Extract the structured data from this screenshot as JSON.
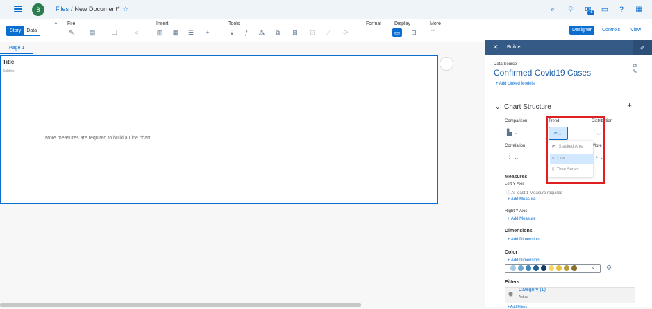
{
  "shell": {
    "avatar_letter": "8",
    "breadcrumb_root": "Files",
    "breadcrumb_sep": "/",
    "document_name": "New Document*",
    "notification_count": "48"
  },
  "toolbar": {
    "mode_story": "Story",
    "mode_data": "Data",
    "groups": {
      "file": "File",
      "insert": "Insert",
      "tools": "Tools",
      "format": "Format",
      "display": "Display",
      "more": "More"
    },
    "more_dots": "•••",
    "views": {
      "designer": "Designer",
      "controls": "Controls",
      "view": "View"
    }
  },
  "page": {
    "tab_label": "Page 1",
    "chart_title": "Title",
    "chart_subtitle": "Subtitle",
    "chart_message": "More measures are required to build a Line chart",
    "more_button": "···"
  },
  "builder": {
    "header": "Builder",
    "data_source_label": "Data Source",
    "data_source_name": "Confirmed Covid19 Cases",
    "add_linked_models": "+ Add Linked Models",
    "chart_structure": "Chart Structure",
    "add_plus": "+",
    "categories": {
      "comparison": "Comparison",
      "trend": "Trend",
      "distribution": "Distribution",
      "correlation": "Correlation",
      "more_label": "More"
    },
    "trend_dropdown": [
      "Stacked Area",
      "Line",
      "Time Series"
    ],
    "measures_label": "Measures",
    "left_y_axis": "Left Y-Axis",
    "measure_required": "At least 1 Measure required",
    "add_measure": "+ Add Measure",
    "right_y_axis": "Right Y-Axis",
    "add_measure_2": "+ Add Measure",
    "dimensions_label": "Dimensions",
    "add_dimension": "+ Add Dimension",
    "color_label": "Color",
    "add_dimension_color": "+ Add Dimension",
    "palette": [
      "#a6c8e0",
      "#6fa8cf",
      "#3d86b8",
      "#1f5f94",
      "#12395e",
      "#f5d66b",
      "#e8c040",
      "#b89a3a",
      "#8a6d2a"
    ],
    "filters_label": "Filters",
    "filter_name": "Category (1)",
    "filter_value": "Actual",
    "add_filters": "+ Add Filters"
  }
}
